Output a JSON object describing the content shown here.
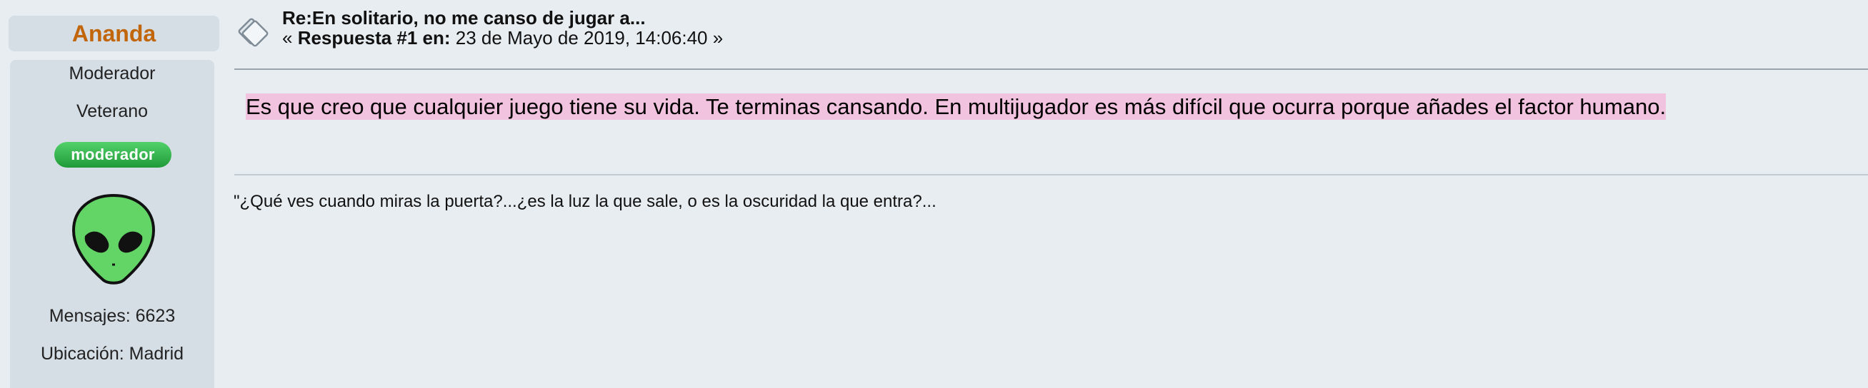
{
  "poster": {
    "name": "Ananda",
    "group": "Moderador",
    "rank": "Veterano",
    "badge": "moderador",
    "avatar": "alien-head-icon",
    "posts_label": "Mensajes: 6623",
    "location_label": "Ubicación: Madrid"
  },
  "message": {
    "icon": "message-thread-icon",
    "title": "Re:En solitario, no me canso de jugar a...",
    "meta_prefix": "« ",
    "meta_label": "Respuesta #1 en:",
    "meta_date": " 23 de Mayo de 2019, 14:06:40 »",
    "body": "Es que creo que cualquier juego tiene su vida. Te terminas cansando. En multijugador es más difícil que ocurra porque añades el factor humano.",
    "signature": "\"¿Qué ves cuando miras la puerta?...¿es la luz la que sale, o es la oscuridad la que entra?..."
  },
  "colors": {
    "background": "#e8edf1",
    "panel": "#d5dde5",
    "poster_name": "#c1660b",
    "badge": "#2eb24c",
    "highlight": "#f2c3df"
  }
}
